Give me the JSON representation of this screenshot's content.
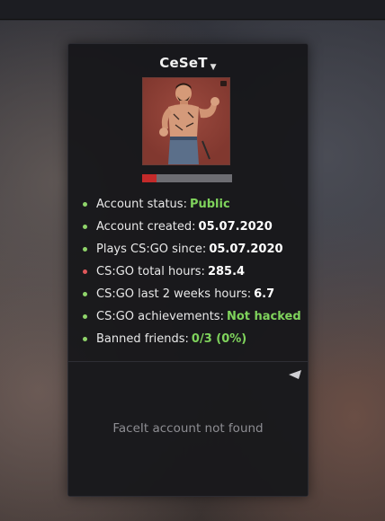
{
  "profile": {
    "username": "CeSeT",
    "level_percent": 16,
    "colors": {
      "green": "#8fd46a",
      "red": "#e0575a",
      "value_green": "#7fd35c",
      "value_white": "#ffffff"
    }
  },
  "stats": [
    {
      "label": "Account status:",
      "value": "Public",
      "dot_color": "#8fd46a",
      "value_color": "#7fd35c"
    },
    {
      "label": "Account created:",
      "value": "05.07.2020",
      "dot_color": "#8fd46a",
      "value_color": "#ffffff"
    },
    {
      "label": "Plays CS:GO since:",
      "value": "05.07.2020",
      "dot_color": "#8fd46a",
      "value_color": "#ffffff"
    },
    {
      "label": "CS:GO total hours:",
      "value": "285.4",
      "dot_color": "#e0575a",
      "value_color": "#ffffff"
    },
    {
      "label": "CS:GO last 2 weeks hours:",
      "value": "6.7",
      "dot_color": "#8fd46a",
      "value_color": "#ffffff"
    },
    {
      "label": "CS:GO achievements:",
      "value": "Not hacked",
      "dot_color": "#8fd46a",
      "value_color": "#7fd35c"
    },
    {
      "label": "Banned friends:",
      "value": "0/3 (0%)",
      "dot_color": "#8fd46a",
      "value_color": "#7fd35c"
    }
  ],
  "faceit": {
    "message": "FaceIt account not found"
  },
  "icons": {
    "caret": "caret-down-icon",
    "corner": "collapse-arrow-icon"
  }
}
